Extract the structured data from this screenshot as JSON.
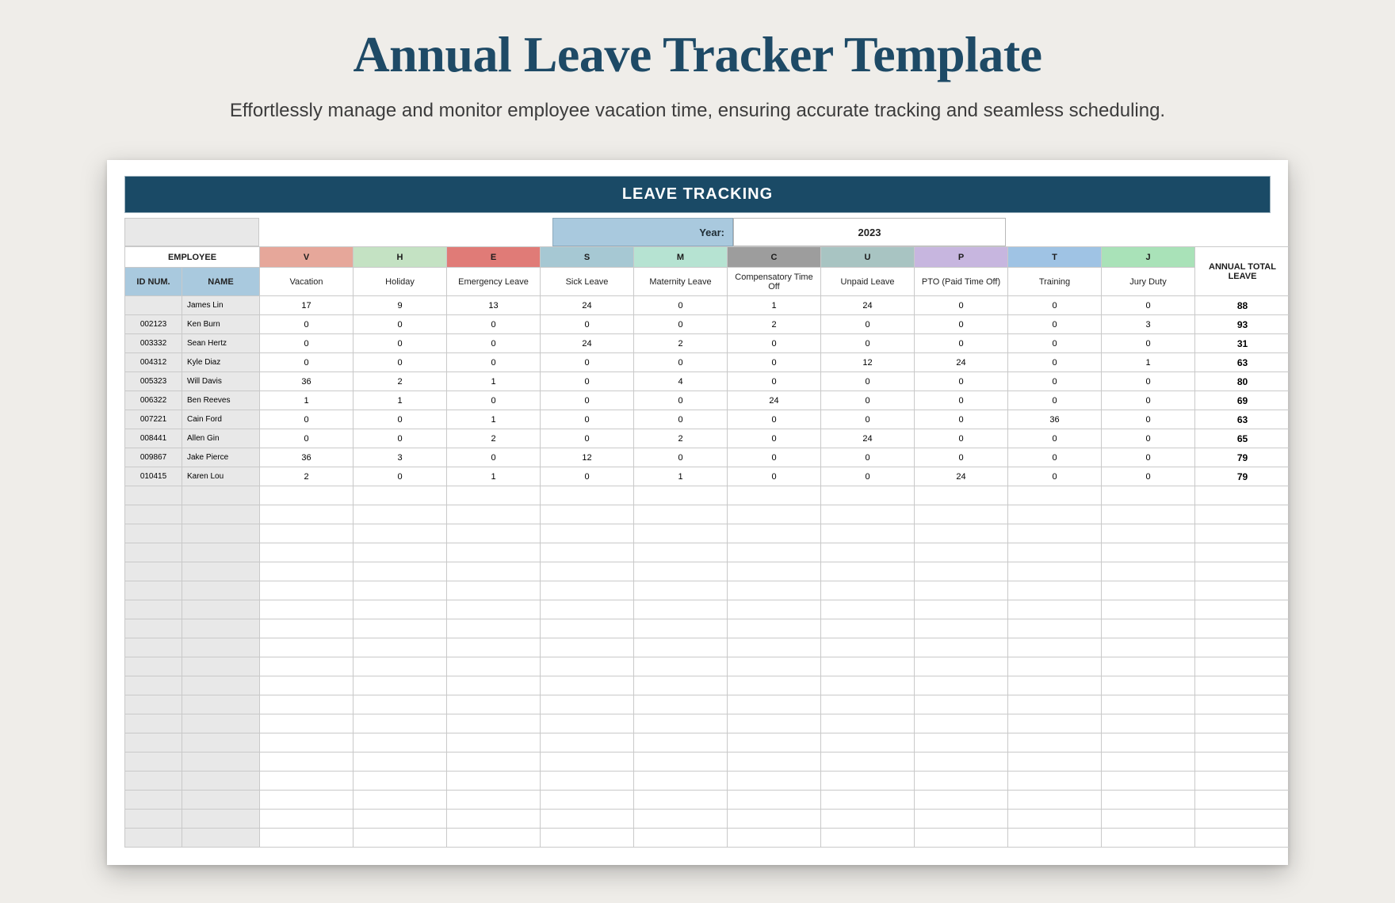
{
  "title": "Annual Leave Tracker Template",
  "subtitle": "Effortlessly manage and monitor employee vacation time, ensuring accurate tracking and seamless scheduling.",
  "sheet": {
    "banner": "LEAVE TRACKING",
    "year_label": "Year:",
    "year_value": "2023",
    "employee_header": "EMPLOYEE",
    "id_header": "ID NUM.",
    "name_header": "NAME",
    "total_header": "ANNUAL TOTAL LEAVE",
    "categories": [
      {
        "code": "V",
        "label": "Vacation",
        "color": "#e6a79a"
      },
      {
        "code": "H",
        "label": "Holiday",
        "color": "#c4e2c3"
      },
      {
        "code": "E",
        "label": "Emergency Leave",
        "color": "#e07b77"
      },
      {
        "code": "S",
        "label": "Sick Leave",
        "color": "#a6c8d3"
      },
      {
        "code": "M",
        "label": "Maternity Leave",
        "color": "#b6e3d2"
      },
      {
        "code": "C",
        "label": "Compensatory Time Off",
        "color": "#9d9d9d"
      },
      {
        "code": "U",
        "label": "Unpaid Leave",
        "color": "#a8c4c2"
      },
      {
        "code": "P",
        "label": "PTO (Paid Time Off)",
        "color": "#c7b6df"
      },
      {
        "code": "T",
        "label": "Training",
        "color": "#9fc3e4"
      },
      {
        "code": "J",
        "label": "Jury Duty",
        "color": "#a9e2b8"
      }
    ],
    "rows": [
      {
        "id": "",
        "name": "James Lin",
        "vals": [
          17,
          9,
          13,
          24,
          0,
          1,
          24,
          0,
          0,
          0
        ],
        "total": 88
      },
      {
        "id": "002123",
        "name": "Ken Burn",
        "vals": [
          0,
          0,
          0,
          0,
          0,
          2,
          0,
          0,
          0,
          3
        ],
        "total": 93
      },
      {
        "id": "003332",
        "name": "Sean Hertz",
        "vals": [
          0,
          0,
          0,
          24,
          2,
          0,
          0,
          0,
          0,
          0
        ],
        "total": 31
      },
      {
        "id": "004312",
        "name": "Kyle Diaz",
        "vals": [
          0,
          0,
          0,
          0,
          0,
          0,
          12,
          24,
          0,
          1
        ],
        "total": 63
      },
      {
        "id": "005323",
        "name": "Will Davis",
        "vals": [
          36,
          2,
          1,
          0,
          4,
          0,
          0,
          0,
          0,
          0
        ],
        "total": 80
      },
      {
        "id": "006322",
        "name": "Ben Reeves",
        "vals": [
          1,
          1,
          0,
          0,
          0,
          24,
          0,
          0,
          0,
          0
        ],
        "total": 69
      },
      {
        "id": "007221",
        "name": "Cain Ford",
        "vals": [
          0,
          0,
          1,
          0,
          0,
          0,
          0,
          0,
          36,
          0
        ],
        "total": 63
      },
      {
        "id": "008441",
        "name": "Allen Gin",
        "vals": [
          0,
          0,
          2,
          0,
          2,
          0,
          24,
          0,
          0,
          0
        ],
        "total": 65
      },
      {
        "id": "009867",
        "name": "Jake Pierce",
        "vals": [
          36,
          3,
          0,
          12,
          0,
          0,
          0,
          0,
          0,
          0
        ],
        "total": 79
      },
      {
        "id": "010415",
        "name": "Karen Lou",
        "vals": [
          2,
          0,
          1,
          0,
          1,
          0,
          0,
          24,
          0,
          0
        ],
        "total": 79
      }
    ],
    "empty_rows": 19
  },
  "chart_data": {
    "type": "table",
    "title": "LEAVE TRACKING",
    "year": 2023,
    "columns": [
      "ID NUM.",
      "NAME",
      "Vacation",
      "Holiday",
      "Emergency Leave",
      "Sick Leave",
      "Maternity Leave",
      "Compensatory Time Off",
      "Unpaid Leave",
      "PTO (Paid Time Off)",
      "Training",
      "Jury Duty",
      "ANNUAL TOTAL LEAVE"
    ],
    "rows": [
      [
        "",
        "James Lin",
        17,
        9,
        13,
        24,
        0,
        1,
        24,
        0,
        0,
        0,
        88
      ],
      [
        "002123",
        "Ken Burn",
        0,
        0,
        0,
        0,
        0,
        2,
        0,
        0,
        0,
        3,
        93
      ],
      [
        "003332",
        "Sean Hertz",
        0,
        0,
        0,
        24,
        2,
        0,
        0,
        0,
        0,
        0,
        31
      ],
      [
        "004312",
        "Kyle Diaz",
        0,
        0,
        0,
        0,
        0,
        0,
        12,
        24,
        0,
        1,
        63
      ],
      [
        "005323",
        "Will Davis",
        36,
        2,
        1,
        0,
        4,
        0,
        0,
        0,
        0,
        0,
        80
      ],
      [
        "006322",
        "Ben Reeves",
        1,
        1,
        0,
        0,
        0,
        24,
        0,
        0,
        0,
        0,
        69
      ],
      [
        "007221",
        "Cain Ford",
        0,
        0,
        1,
        0,
        0,
        0,
        0,
        0,
        36,
        0,
        63
      ],
      [
        "008441",
        "Allen Gin",
        0,
        0,
        2,
        0,
        2,
        0,
        24,
        0,
        0,
        0,
        65
      ],
      [
        "009867",
        "Jake Pierce",
        36,
        3,
        0,
        12,
        0,
        0,
        0,
        0,
        0,
        0,
        79
      ],
      [
        "010415",
        "Karen Lou",
        2,
        0,
        1,
        0,
        1,
        0,
        0,
        24,
        0,
        0,
        79
      ]
    ]
  }
}
